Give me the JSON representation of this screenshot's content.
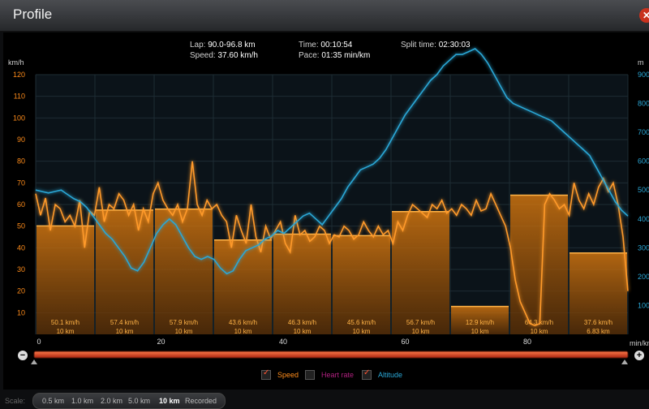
{
  "window": {
    "title": "Profile",
    "close_icon": "close-icon"
  },
  "header": {
    "lap_label": "Lap:",
    "lap_value": "90.0-96.8 km",
    "speed_label": "Speed:",
    "speed_value": "37.60 km/h",
    "time_label": "Time:",
    "time_value": "00:10:54",
    "pace_label": "Pace:",
    "pace_value": "01:35 min/km",
    "split_label": "Split time:",
    "split_value": "02:30:03"
  },
  "chart_data": {
    "type": "area",
    "left_unit": "km/h",
    "right_unit": "m",
    "x_unit": "min/km",
    "y_ticks": [
      10,
      20,
      30,
      40,
      50,
      60,
      70,
      80,
      90,
      100,
      110,
      120
    ],
    "y2_ticks": [
      100,
      200,
      300,
      400,
      500,
      600,
      700,
      800,
      900
    ],
    "x_ticks": [
      0,
      20,
      40,
      60,
      80
    ],
    "segments": [
      {
        "speed": "50.1 km/h",
        "dist": "10 km",
        "value": 50.1
      },
      {
        "speed": "57.4 km/h",
        "dist": "10 km",
        "value": 57.4
      },
      {
        "speed": "57.9 km/h",
        "dist": "10 km",
        "value": 57.9
      },
      {
        "speed": "43.6 km/h",
        "dist": "10 km",
        "value": 43.6
      },
      {
        "speed": "46.3 km/h",
        "dist": "10 km",
        "value": 46.3
      },
      {
        "speed": "45.6 km/h",
        "dist": "10 km",
        "value": 45.6
      },
      {
        "speed": "56.7 km/h",
        "dist": "10 km",
        "value": 56.7
      },
      {
        "speed": "12.9 km/h",
        "dist": "10 km",
        "value": 12.9
      },
      {
        "speed": "64.3 km/h",
        "dist": "10 km",
        "value": 64.3
      },
      {
        "speed": "37.6 km/h",
        "dist": "6.83 km",
        "value": 37.6
      }
    ],
    "speed_line": [
      65,
      55,
      63,
      48,
      60,
      58,
      52,
      55,
      50,
      62,
      40,
      57,
      55,
      68,
      52,
      60,
      58,
      65,
      62,
      55,
      60,
      48,
      58,
      52,
      65,
      70,
      62,
      58,
      55,
      60,
      52,
      58,
      80,
      60,
      55,
      62,
      58,
      60,
      55,
      52,
      40,
      55,
      48,
      42,
      60,
      45,
      38,
      50,
      44,
      48,
      52,
      42,
      38,
      55,
      46,
      48,
      43,
      45,
      50,
      48,
      42,
      46,
      45,
      50,
      48,
      44,
      46,
      52,
      48,
      45,
      50,
      46,
      48,
      42,
      52,
      48,
      55,
      60,
      58,
      56,
      54,
      60,
      58,
      62,
      56,
      58,
      55,
      60,
      58,
      55,
      62,
      57,
      58,
      65,
      60,
      55,
      50,
      40,
      25,
      15,
      10,
      5,
      4,
      5,
      60,
      65,
      62,
      58,
      60,
      55,
      70,
      62,
      58,
      65,
      60,
      68,
      72,
      66,
      70,
      60,
      45,
      20
    ],
    "altitude_line": [
      500,
      495,
      490,
      495,
      500,
      485,
      470,
      460,
      440,
      410,
      380,
      350,
      330,
      300,
      270,
      230,
      220,
      250,
      300,
      350,
      380,
      400,
      380,
      340,
      300,
      270,
      260,
      270,
      260,
      230,
      210,
      220,
      260,
      290,
      300,
      310,
      330,
      340,
      360,
      350,
      370,
      390,
      410,
      420,
      400,
      380,
      410,
      440,
      470,
      510,
      540,
      570,
      580,
      590,
      610,
      640,
      680,
      720,
      760,
      790,
      820,
      850,
      880,
      900,
      930,
      950,
      970,
      970,
      980,
      990,
      970,
      940,
      900,
      860,
      820,
      800,
      790,
      780,
      770,
      760,
      750,
      740,
      720,
      700,
      680,
      660,
      640,
      620,
      580,
      540,
      500,
      460,
      430,
      410
    ],
    "altitude_range": [
      0,
      900
    ]
  },
  "legend": {
    "speed": {
      "label": "Speed",
      "checked": true,
      "color": "#ff8c1a"
    },
    "heart": {
      "label": "Heart rate",
      "checked": false,
      "color": "#d0259b"
    },
    "alt": {
      "label": "Altitude",
      "checked": true,
      "color": "#2aa7d6"
    }
  },
  "scale": {
    "label": "Scale:",
    "options": [
      "0.5 km",
      "1.0 km",
      "2.0 km",
      "5.0 km",
      "10 km",
      "Recorded"
    ],
    "active": "10 km"
  },
  "colors": {
    "speed": "#ff8c1a",
    "altitude": "#2aa7d6",
    "slider": "#e0472a"
  }
}
